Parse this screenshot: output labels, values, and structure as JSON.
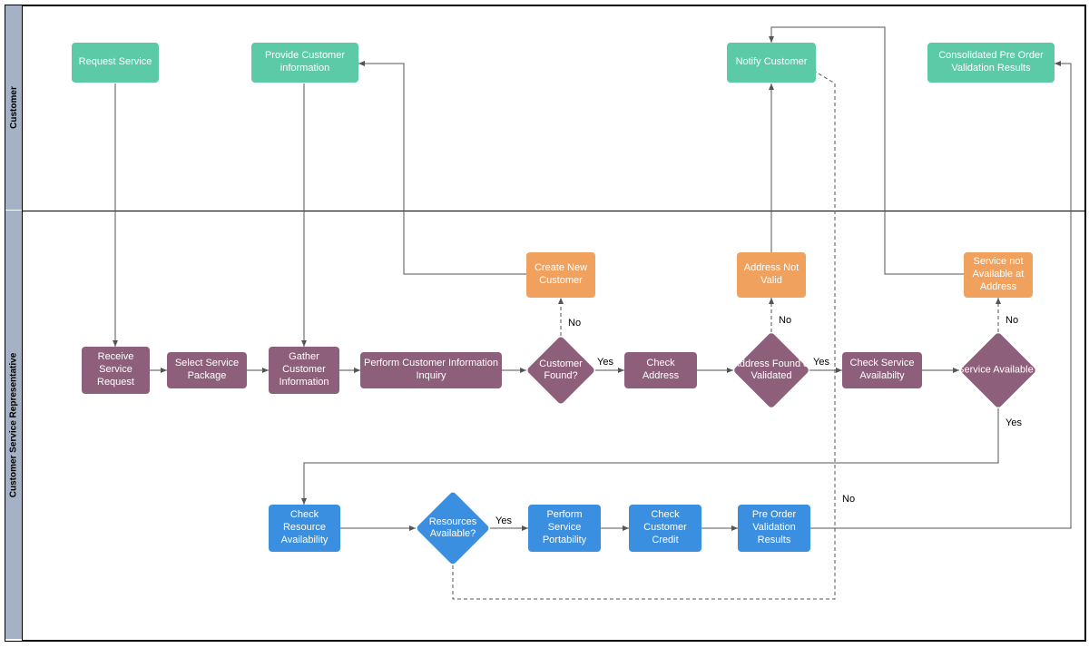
{
  "lanes": {
    "customer": "Customer",
    "csr": "Customer Service Representative"
  },
  "nodes": {
    "request_service": "Request Service",
    "provide_info": "Provide Customer information",
    "notify_customer": "Notify Customer",
    "consolidated": "Consolidated Pre Order Validation Results",
    "receive": "Receive Service Request",
    "select_pkg": "Select Service Package",
    "gather": "Gather Customer Information",
    "inquiry": "Perform Customer Information Inquiry",
    "customer_found": "Customer Found?",
    "create_new": "Create New Customer",
    "check_addr": "Check Address",
    "addr_valid": "Address Found & Validated",
    "addr_not_valid": "Address Not Valid",
    "check_svc": "Check Service Availabilty",
    "svc_avail": "Service Available?",
    "svc_not": "Service not Available at Address",
    "check_res": "Check Resource Availability",
    "res_avail": "Resources Available?",
    "perform_port": "Perform Service Portability",
    "check_credit": "Check Customer Credit",
    "pre_order": "Pre Order Validation Results"
  },
  "labels": {
    "yes": "Yes",
    "no": "No"
  }
}
